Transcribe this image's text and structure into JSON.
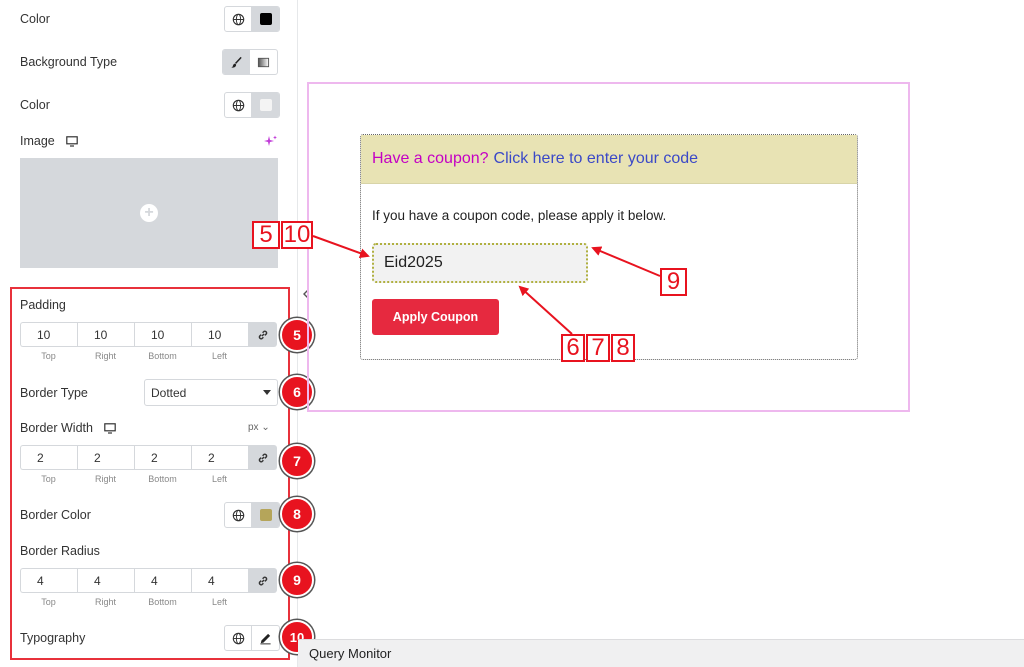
{
  "panel": {
    "color_label": "Color",
    "background_type_label": "Background Type",
    "color2_label": "Color",
    "image_label": "Image",
    "padding": {
      "label": "Padding",
      "values": [
        "10",
        "10",
        "10",
        "10"
      ],
      "sides": [
        "Top",
        "Right",
        "Bottom",
        "Left"
      ]
    },
    "border_type": {
      "label": "Border Type",
      "value": "Dotted"
    },
    "border_width": {
      "label": "Border Width",
      "unit": "px",
      "values": [
        "2",
        "2",
        "2",
        "2"
      ],
      "sides": [
        "Top",
        "Right",
        "Bottom",
        "Left"
      ]
    },
    "border_color": {
      "label": "Border Color",
      "swatch": "#b5a55a"
    },
    "border_radius": {
      "label": "Border Radius",
      "values": [
        "4",
        "4",
        "4",
        "4"
      ],
      "sides": [
        "Top",
        "Right",
        "Bottom",
        "Left"
      ]
    },
    "typography_label": "Typography",
    "badges": [
      "5",
      "6",
      "7",
      "8",
      "9",
      "10"
    ]
  },
  "canvas": {
    "coupon_question": "Have a coupon?",
    "coupon_link": "Click here to enter your code",
    "coupon_text": "If you have a coupon code, please apply it below.",
    "coupon_value": "Eid2025",
    "apply_label": "Apply Coupon"
  },
  "annotations": {
    "box_5": "5",
    "box_10": "10",
    "box_9": "9",
    "box_6": "6",
    "box_7": "7",
    "box_8": "8"
  },
  "footer": {
    "query_monitor": "Query Monitor"
  },
  "colors": {
    "accent_red": "#e8131f",
    "apply_button": "#e6293f",
    "coupon_header_bg": "#e8e3b4",
    "coupon_question": "#c400c4",
    "coupon_link": "#3b49c7"
  }
}
